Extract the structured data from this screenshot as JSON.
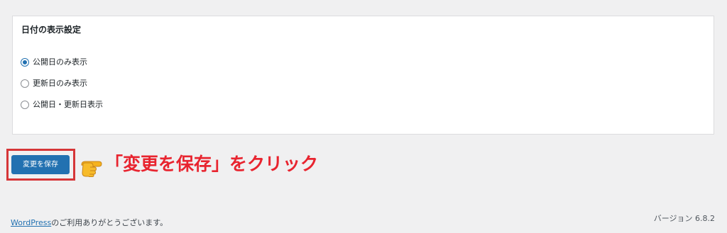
{
  "settings_panel": {
    "title": "日付の表示設定",
    "options": [
      {
        "label": "公開日のみ表示",
        "checked": true
      },
      {
        "label": "更新日のみ表示",
        "checked": false
      },
      {
        "label": "公開日・更新日表示",
        "checked": false
      }
    ]
  },
  "save_button": {
    "label": "変更を保存"
  },
  "annotation": {
    "text": "「変更を保存」をクリック",
    "color": "#e8242f",
    "icon": "pointing-hand-icon"
  },
  "footer": {
    "link_text": "WordPress",
    "text": "のご利用ありがとうございます。",
    "version": "バージョン 6.8.2"
  },
  "colors": {
    "accent": "#2271b1",
    "highlight": "#d63638",
    "background": "#f0f0f1"
  }
}
